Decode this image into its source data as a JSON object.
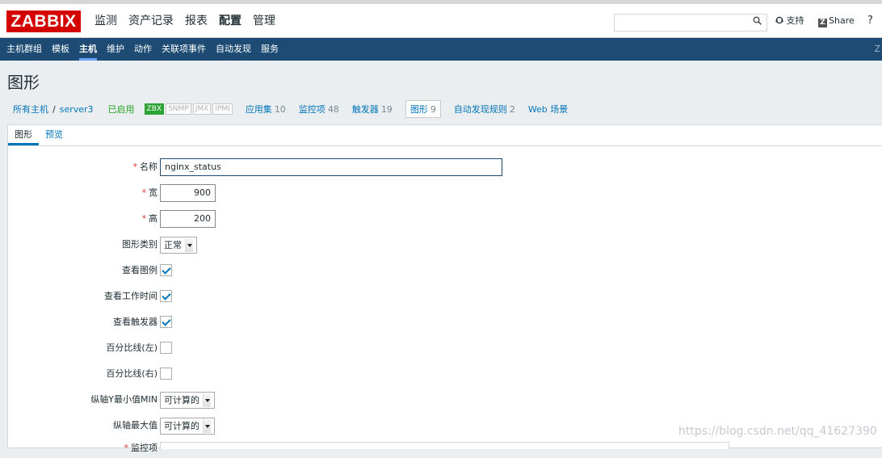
{
  "app": {
    "logo": "ZABBIX"
  },
  "topbar": {
    "menu": [
      "监测",
      "资产记录",
      "报表",
      "配置",
      "管理"
    ],
    "selected_menu": "配置",
    "search_icon": "search-icon",
    "support": "支持",
    "share": "Share",
    "share_icon_letter": "Z",
    "help": "?"
  },
  "subnav": {
    "items": [
      "主机群组",
      "模板",
      "主机",
      "维护",
      "动作",
      "关联项事件",
      "自动发现",
      "服务"
    ],
    "selected": "主机",
    "right": "Z"
  },
  "page": {
    "title": "图形"
  },
  "breadcrumb": {
    "all_hosts": "所有主机",
    "separator": "/",
    "host": "server3",
    "status": "已启用",
    "tags": [
      "ZBX",
      "SNMP",
      "JMX",
      "IPMI"
    ],
    "nav": [
      {
        "label": "应用集",
        "count": "10"
      },
      {
        "label": "监控项",
        "count": "48"
      },
      {
        "label": "触发器",
        "count": "19"
      },
      {
        "label": "图形",
        "count": "9"
      },
      {
        "label": "自动发现规则",
        "count": "2"
      },
      {
        "label": "Web 场景",
        "count": ""
      }
    ]
  },
  "tabs": {
    "graph": "图形",
    "preview": "预览"
  },
  "form": {
    "required_mark": "*",
    "name_label": "名称",
    "name_value": "nginx_status",
    "width_label": "宽",
    "width_value": "900",
    "height_label": "高",
    "height_value": "200",
    "type_label": "图形类别",
    "type_value": "正常",
    "legend_label": "查看图例",
    "legend_checked": true,
    "worktime_label": "查看工作时间",
    "worktime_checked": true,
    "triggers_label": "查看触发器",
    "triggers_checked": true,
    "pleft_label": "百分比线(左)",
    "pleft_checked": false,
    "pright_label": "百分比线(右)",
    "pright_checked": false,
    "ymin_label": "纵轴Y最小值MIN",
    "ymin_value": "可计算的",
    "ymax_label": "纵轴最大值",
    "ymax_value": "可计算的",
    "items_label": "监控项"
  },
  "watermark": "https://blog.csdn.net/qq_41627390"
}
